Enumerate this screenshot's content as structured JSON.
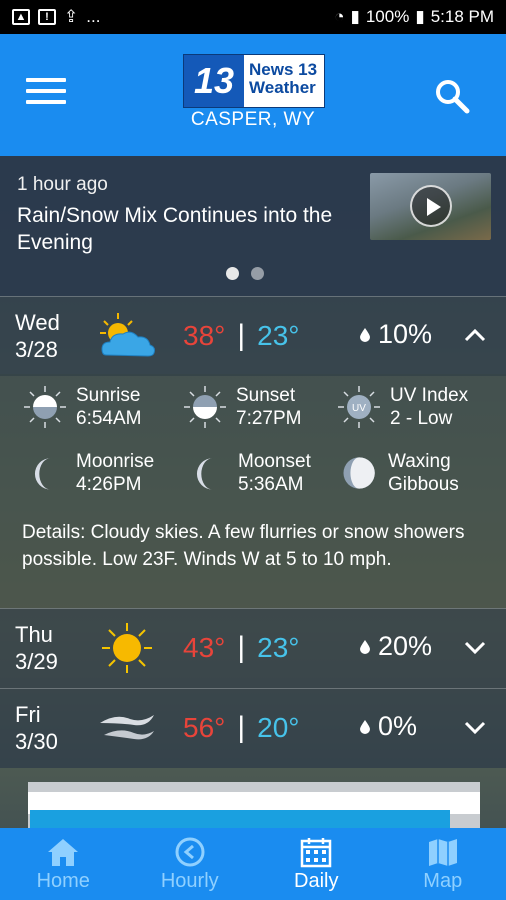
{
  "status_bar": {
    "battery": "100%",
    "time": "5:18 PM",
    "more": "..."
  },
  "header": {
    "logo_number": "13",
    "logo_line1": "News 13",
    "logo_line2": "Weather",
    "location": "CASPER, WY",
    "accent_color": "#1a8cf0"
  },
  "news": {
    "time": "1 hour ago",
    "title": "Rain/Snow Mix Continues into the Evening",
    "carousel_pages": 2,
    "active_page": 1
  },
  "days": [
    {
      "day": "Wed",
      "date": "3/28",
      "icon": "partly-cloudy-icon",
      "high": "38°",
      "low": "23°",
      "precip": "10%",
      "expanded": true
    },
    {
      "day": "Thu",
      "date": "3/29",
      "icon": "sunny-icon",
      "high": "43°",
      "low": "23°",
      "precip": "20%",
      "expanded": false
    },
    {
      "day": "Fri",
      "date": "3/30",
      "icon": "windy-icon",
      "high": "56°",
      "low": "20°",
      "precip": "0%",
      "expanded": false
    }
  ],
  "details": {
    "sunrise_label": "Sunrise",
    "sunrise": "6:54AM",
    "sunset_label": "Sunset",
    "sunset": "7:27PM",
    "uv_label": "UV Index",
    "uv": "2 - Low",
    "moonrise_label": "Moonrise",
    "moonrise": "4:26PM",
    "moonset_label": "Moonset",
    "moonset": "5:36AM",
    "phase_line1": "Waxing",
    "phase_line2": "Gibbous",
    "text": "Details: Cloudy skies. A few flurries or snow showers possible. Low 23F. Winds W at 5 to 10 mph."
  },
  "nav": [
    {
      "label": "Home",
      "icon": "home-icon"
    },
    {
      "label": "Hourly",
      "icon": "hourly-icon"
    },
    {
      "label": "Daily",
      "icon": "calendar-icon",
      "active": true
    },
    {
      "label": "Map",
      "icon": "map-icon"
    }
  ],
  "colors": {
    "high": "#e8443a",
    "low": "#47c3ea"
  }
}
